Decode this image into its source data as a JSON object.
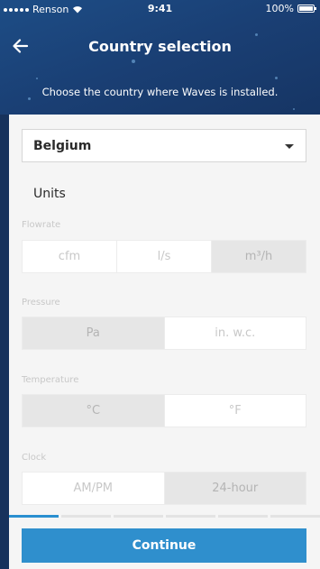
{
  "status_bar": {
    "carrier": "Renson",
    "time": "9:41",
    "battery": "100%"
  },
  "header": {
    "title": "Country selection",
    "subtitle": "Choose the country where Waves is installed."
  },
  "country": {
    "selected": "Belgium"
  },
  "units": {
    "heading": "Units",
    "flowrate": {
      "label": "Flowrate",
      "options": [
        "cfm",
        "l/s",
        "m³/h"
      ],
      "selected": "m³/h"
    },
    "pressure": {
      "label": "Pressure",
      "options": [
        "Pa",
        "in. w.c."
      ],
      "selected": "Pa"
    },
    "temperature": {
      "label": "Temperature",
      "options": [
        "°C",
        "°F"
      ],
      "selected": "°C"
    },
    "clock": {
      "label": "Clock",
      "options": [
        "AM/PM",
        "24-hour"
      ],
      "selected": "24-hour"
    }
  },
  "progress": {
    "total_steps": 6,
    "current_step": 1
  },
  "footer": {
    "continue_label": "Continue"
  },
  "colors": {
    "accent": "#2f8fcd",
    "header_bg": "#1d4d86"
  }
}
